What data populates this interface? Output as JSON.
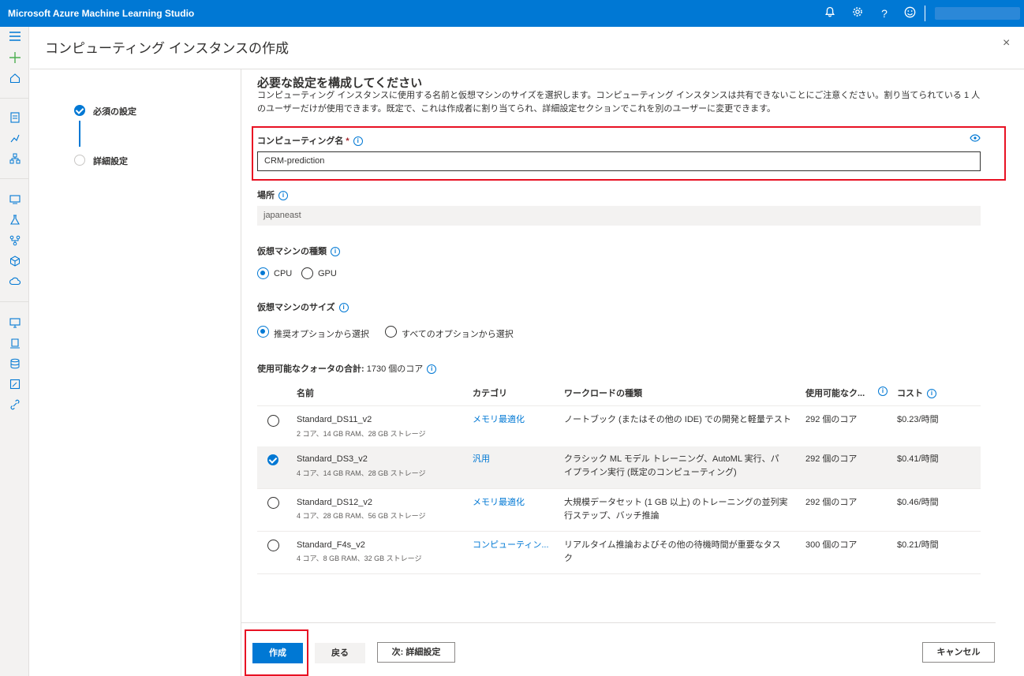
{
  "app": {
    "title": "Microsoft Azure Machine Learning Studio",
    "topbar_icons": [
      "bell-icon",
      "gear-icon",
      "help-icon",
      "smiley-icon"
    ],
    "help_glyph": "?",
    "accent": "#0078d4"
  },
  "panel": {
    "title": "コンピューティング インスタンスの作成",
    "close": "×"
  },
  "steps": [
    {
      "label": "必須の設定",
      "state": "completed"
    },
    {
      "label": "詳細設定",
      "state": "pending"
    }
  ],
  "form": {
    "heading": "必要な設定を構成してください",
    "description": "コンピューティング インスタンスに使用する名前と仮想マシンのサイズを選択します。コンピューティング インスタンスは共有できないことにご注意ください。割り当てられている 1 人のユーザーだけが使用できます。既定で、これは作成者に割り当てられ、詳細設定セクションでこれを別のユーザーに変更できます。",
    "name_label": "コンピューティング名",
    "required_mark": "*",
    "name_value": "CRM-prediction",
    "location_label": "場所",
    "location_value": "japaneast",
    "vm_type_label": "仮想マシンの種類",
    "vm_type_options": [
      "CPU",
      "GPU"
    ],
    "vm_type_selected": "CPU",
    "vm_size_label": "仮想マシンのサイズ",
    "vm_size_options": [
      "推奨オプションから選択",
      "すべてのオプションから選択"
    ],
    "vm_size_selected": "推奨オプションから選択",
    "quota_label": "使用可能なクォータの合計:",
    "quota_value": "1730 個のコア"
  },
  "table": {
    "columns": [
      "名前",
      "カテゴリ",
      "ワークロードの種類",
      "使用可能なク...",
      "コスト"
    ],
    "rows": [
      {
        "name": "Standard_DS11_v2",
        "spec": "2 コア、14 GB RAM、28 GB ストレージ",
        "category": "メモリ最適化",
        "workload_1": "ノートブック (またはその他の IDE) での開発と軽量テスト",
        "workload_2": "",
        "quota": "292 個のコア",
        "cost": "$0.23/時間",
        "selected": false
      },
      {
        "name": "Standard_DS3_v2",
        "spec": "4 コア、14 GB RAM、28 GB ストレージ",
        "category": "汎用",
        "workload_1": "クラシック ML モデル トレーニング、AutoML 実行、パ",
        "workload_2": "イプライン実行 (既定のコンピューティング)",
        "quota": "292 個のコア",
        "cost": "$0.41/時間",
        "selected": true
      },
      {
        "name": "Standard_DS12_v2",
        "spec": "4 コア、28 GB RAM、56 GB ストレージ",
        "category": "メモリ最適化",
        "workload_1": "大規模データセット (1 GB 以上) のトレーニングの並列実",
        "workload_2": "行ステップ、バッチ推論",
        "quota": "292 個のコア",
        "cost": "$0.46/時間",
        "selected": false
      },
      {
        "name": "Standard_F4s_v2",
        "spec": "4 コア、8 GB RAM、32 GB ストレージ",
        "category": "コンピューティン...",
        "workload_1": "リアルタイム推論およびその他の待機時間が重要なタス",
        "workload_2": "ク",
        "quota": "300 個のコア",
        "cost": "$0.21/時間",
        "selected": false
      }
    ]
  },
  "footer": {
    "create": "作成",
    "back": "戻る",
    "next": "次: 詳細設定",
    "cancel": "キャンセル"
  }
}
